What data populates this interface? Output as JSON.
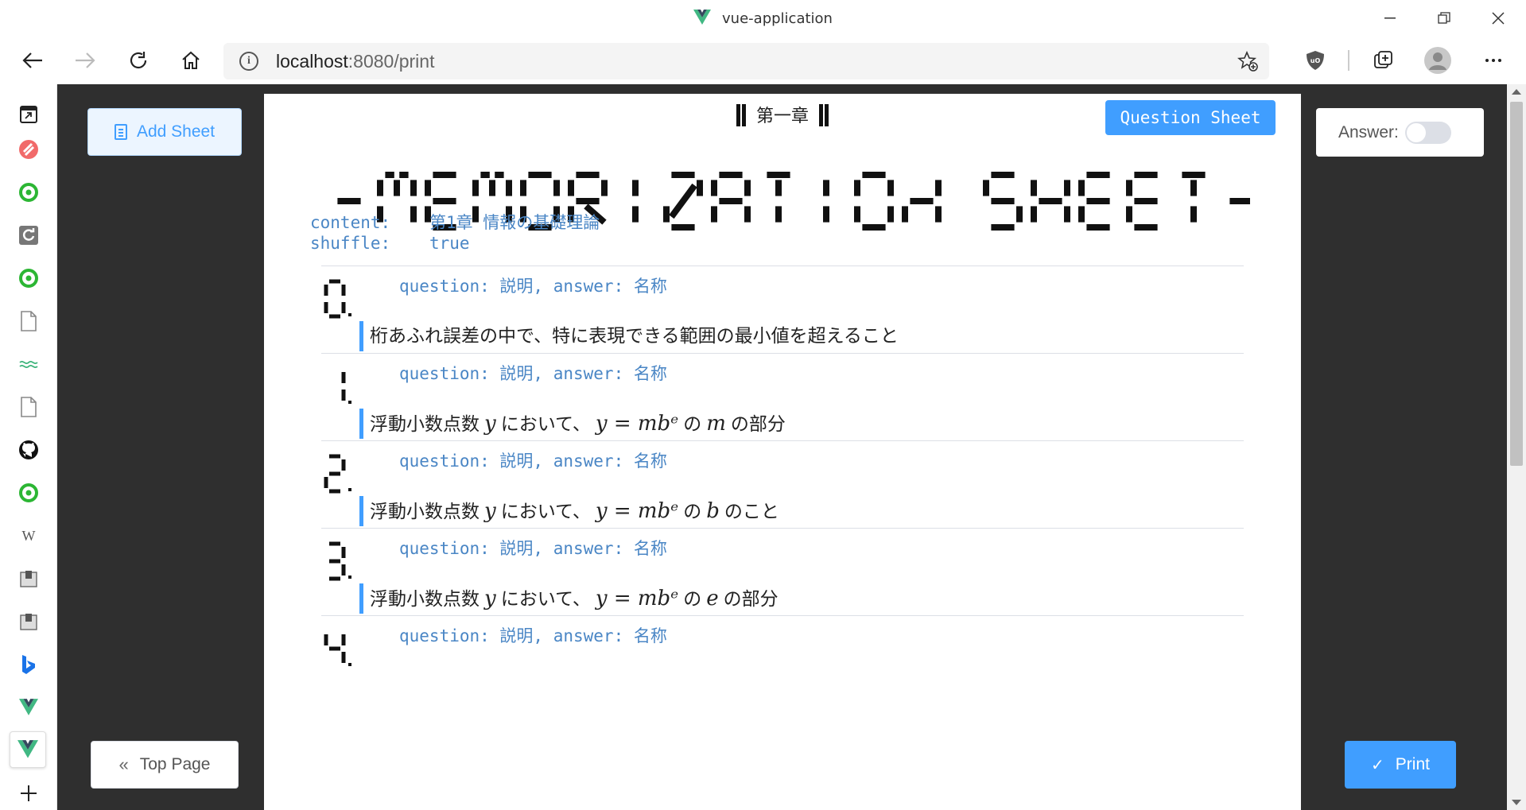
{
  "window": {
    "title": "vue-application",
    "url_host": "localhost",
    "url_path": ":8080/print"
  },
  "app": {
    "add_sheet_label": "Add Sheet",
    "answer_label": "Answer:",
    "answer_toggle_on": false,
    "top_page_label": "Top Page",
    "print_label": "Print"
  },
  "sheet": {
    "chapter": "第一章",
    "badge": "Question Sheet",
    "title": "-MEMORIZATION SHEET-",
    "content_key": "content:",
    "content_value": "第1章 情報の基礎理論",
    "shuffle_key": "shuffle:",
    "shuffle_value": "true",
    "items": [
      {
        "num": "0.",
        "question": "question: 説明, answer: 名称",
        "desc_a": "桁あふれ誤差の中で、特に表現できる範囲の最小値を超えること",
        "m1": "",
        "desc_b": "",
        "m2": "",
        "desc_c": "",
        "m3": "",
        "desc_d": ""
      },
      {
        "num": "1.",
        "question": "question: 説明, answer: 名称",
        "desc_a": "浮動小数点数",
        "m1": "y",
        "desc_b": "において、",
        "m2": "y = mbᵉ",
        "desc_c": "の",
        "m3": "m",
        "desc_d": "の部分"
      },
      {
        "num": "2.",
        "question": "question: 説明, answer: 名称",
        "desc_a": "浮動小数点数",
        "m1": "y",
        "desc_b": "において、",
        "m2": "y = mbᵉ",
        "desc_c": "の",
        "m3": "b",
        "desc_d": "のこと"
      },
      {
        "num": "3.",
        "question": "question: 説明, answer: 名称",
        "desc_a": "浮動小数点数",
        "m1": "y",
        "desc_b": "において、",
        "m2": "y = mbᵉ",
        "desc_c": "の",
        "m3": "e",
        "desc_d": "の部分"
      },
      {
        "num": "4.",
        "question": "question: 説明, answer: 名称"
      }
    ]
  },
  "colors": {
    "accent": "#409eff",
    "key_text": "#4a86c5",
    "app_bg": "#2f2f2f"
  }
}
